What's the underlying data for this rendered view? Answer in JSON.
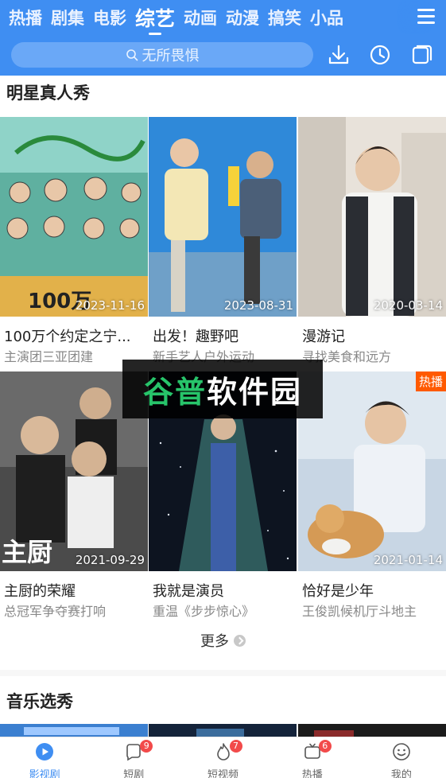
{
  "header": {
    "tabs": [
      "热播",
      "剧集",
      "电影",
      "综艺",
      "动画",
      "动漫",
      "搞笑",
      "小品"
    ],
    "active_tab": "综艺",
    "search_placeholder": "无所畏惧",
    "icons": [
      "download-icon",
      "history-icon",
      "multiscreen-icon",
      "menu-icon"
    ]
  },
  "sections": [
    {
      "title": "明星真人秀",
      "cards": [
        {
          "title": "100万个约定之宁...",
          "sub": "主演团三亚团建",
          "date": "2023-11-16",
          "badge": ""
        },
        {
          "title": "出发！趣野吧",
          "sub": "新手艺人户外运动",
          "date": "2023-08-31",
          "badge": ""
        },
        {
          "title": "漫游记",
          "sub": "寻找美食和远方",
          "date": "2020-03-14",
          "badge": ""
        },
        {
          "title": "主厨的荣耀",
          "sub": "总冠军争夺赛打响",
          "date": "2021-09-29",
          "badge": ""
        },
        {
          "title": "我就是演员",
          "sub": "重温《步步惊心》",
          "date": "",
          "badge": ""
        },
        {
          "title": "恰好是少年",
          "sub": "王俊凯候机厅斗地主",
          "date": "2021-01-14",
          "badge": "热播"
        }
      ],
      "more_label": "更多"
    },
    {
      "title": "音乐选秀"
    }
  ],
  "watermark": {
    "text_a": "谷普",
    "text_b": "软件园"
  },
  "bottom_nav": [
    {
      "label": "影视剧",
      "badge": "",
      "icon": "play-icon",
      "active": true
    },
    {
      "label": "短剧",
      "badge": "9",
      "icon": "short-drama-icon",
      "active": false
    },
    {
      "label": "短视频",
      "badge": "7",
      "icon": "flame-icon",
      "active": false
    },
    {
      "label": "热播",
      "badge": "6",
      "icon": "hot-tv-icon",
      "active": false
    },
    {
      "label": "我的",
      "badge": "",
      "icon": "smiley-icon",
      "active": false
    }
  ],
  "colors": {
    "accent": "#3f8ef2",
    "badge": "#f24a4a",
    "hot": "#ff5a00"
  }
}
